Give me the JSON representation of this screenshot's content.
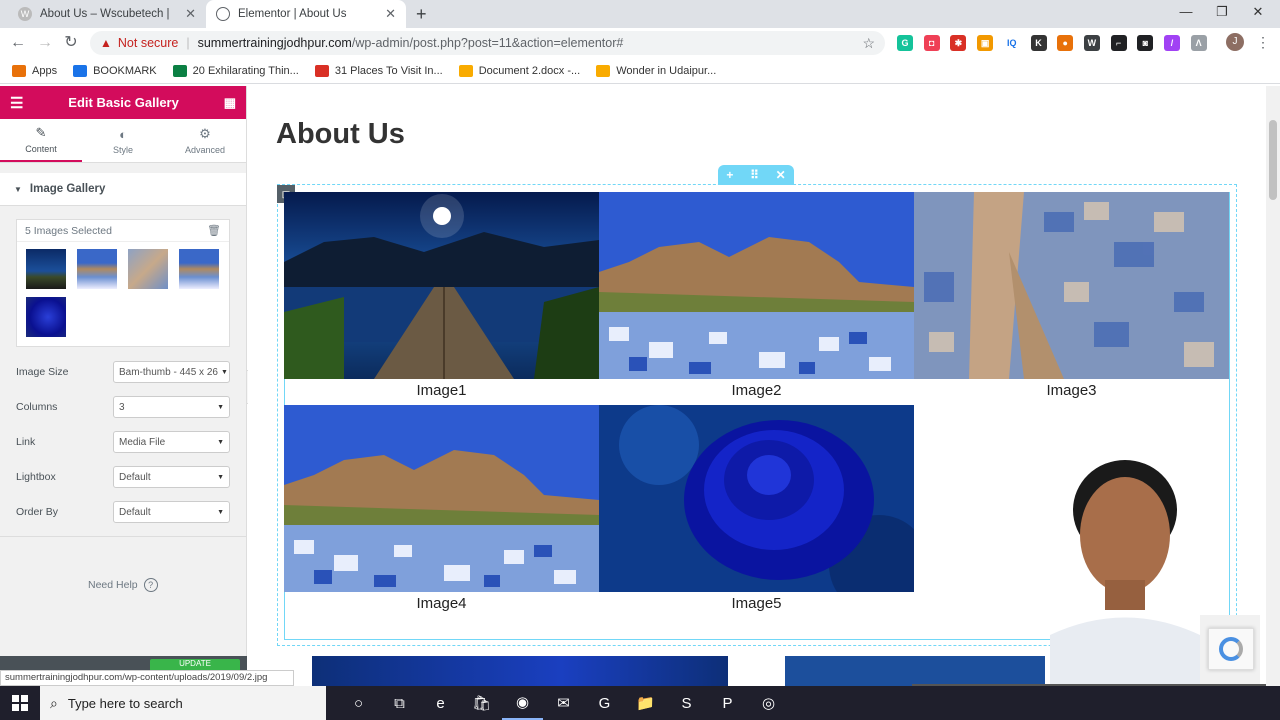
{
  "tabs": [
    {
      "title": "About Us – Wscubetech |",
      "active": false
    },
    {
      "title": "Elementor | About Us",
      "active": true
    }
  ],
  "new_tab": "+",
  "window_controls": {
    "minimize": "—",
    "restore": "❐",
    "close": "✕"
  },
  "address": {
    "security_label": "Not secure",
    "host": "summertrainingjodhpur.com",
    "path": "/wp-admin/post.php?post=11&action=elementor#"
  },
  "extensions": [
    {
      "name": "grammarly-icon",
      "color": "#15c39a",
      "label": "G"
    },
    {
      "name": "pocket-icon",
      "color": "#ef4056",
      "label": "◘"
    },
    {
      "name": "puzzle-icon",
      "color": "#d93025",
      "label": "✱"
    },
    {
      "name": "image-icon",
      "color": "#f29900",
      "label": "▣"
    },
    {
      "name": "iq-icon",
      "color": "#ffffff",
      "label": "IQ",
      "text": "#1a73e8"
    },
    {
      "name": "k-icon",
      "color": "#333333",
      "label": "K"
    },
    {
      "name": "color-wheel-icon",
      "color": "#e8710a",
      "label": "●"
    },
    {
      "name": "wordpress-icon",
      "color": "#3c4043",
      "label": "W"
    },
    {
      "name": "crop-icon",
      "color": "#202124",
      "label": "⌐"
    },
    {
      "name": "camera-icon",
      "color": "#202124",
      "label": "◙"
    },
    {
      "name": "pen-icon",
      "color": "#a142f4",
      "label": "/"
    },
    {
      "name": "a-icon",
      "color": "#9aa0a6",
      "label": "Λ"
    }
  ],
  "profile_initial": "J",
  "bookmarks": [
    {
      "label": "Apps",
      "color": "#e8710a"
    },
    {
      "label": "BOOKMARK",
      "color": "#1a73e8"
    },
    {
      "label": "20 Exhilarating Thin...",
      "color": "#0b8043"
    },
    {
      "label": "31 Places To Visit In...",
      "color": "#d93025"
    },
    {
      "label": "Document 2.docx -...",
      "color": "#f9ab00"
    },
    {
      "label": "Wonder in Udaipur...",
      "color": "#f9ab00"
    }
  ],
  "panel": {
    "title": "Edit Basic Gallery",
    "tabs": [
      {
        "label": "Content",
        "icon": "✎"
      },
      {
        "label": "Style",
        "icon": "◐"
      },
      {
        "label": "Advanced",
        "icon": "⚙"
      }
    ],
    "section_title": "Image Gallery",
    "gallery_count": "5 Images Selected",
    "fields": [
      {
        "label": "Image Size",
        "value": "Bam-thumb - 445 x 26"
      },
      {
        "label": "Columns",
        "value": "3"
      },
      {
        "label": "Link",
        "value": "Media File"
      },
      {
        "label": "Lightbox",
        "value": "Default"
      },
      {
        "label": "Order By",
        "value": "Default"
      }
    ],
    "help": "Need Help",
    "update_button": "UPDATE"
  },
  "page": {
    "title": "About Us",
    "gallery": [
      {
        "caption": "Image1",
        "scene": "lake-pier"
      },
      {
        "caption": "Image2",
        "scene": "fort-blue-city"
      },
      {
        "caption": "Image3",
        "scene": "aerial-city"
      },
      {
        "caption": "Image4",
        "scene": "fort-blue-city"
      },
      {
        "caption": "Image5",
        "scene": "blue-rose"
      }
    ]
  },
  "status_url": "summertrainingjodhpur.com/wp-content/uploads/2019/09/2.jpg",
  "taskbar": {
    "search_placeholder": "Type here to search",
    "apps": [
      {
        "name": "cortana-icon",
        "glyph": "○"
      },
      {
        "name": "task-view-icon",
        "glyph": "⧉"
      },
      {
        "name": "edge-icon",
        "glyph": "e"
      },
      {
        "name": "store-icon",
        "glyph": "🛍"
      },
      {
        "name": "chrome-icon",
        "glyph": "◉"
      },
      {
        "name": "mail-icon",
        "glyph": "✉"
      },
      {
        "name": "grammarly-icon",
        "glyph": "G"
      },
      {
        "name": "file-explorer-icon",
        "glyph": "📁"
      },
      {
        "name": "sublime-icon",
        "glyph": "S"
      },
      {
        "name": "powerpoint-icon",
        "glyph": "P"
      },
      {
        "name": "obs-icon",
        "glyph": "◎"
      }
    ]
  }
}
